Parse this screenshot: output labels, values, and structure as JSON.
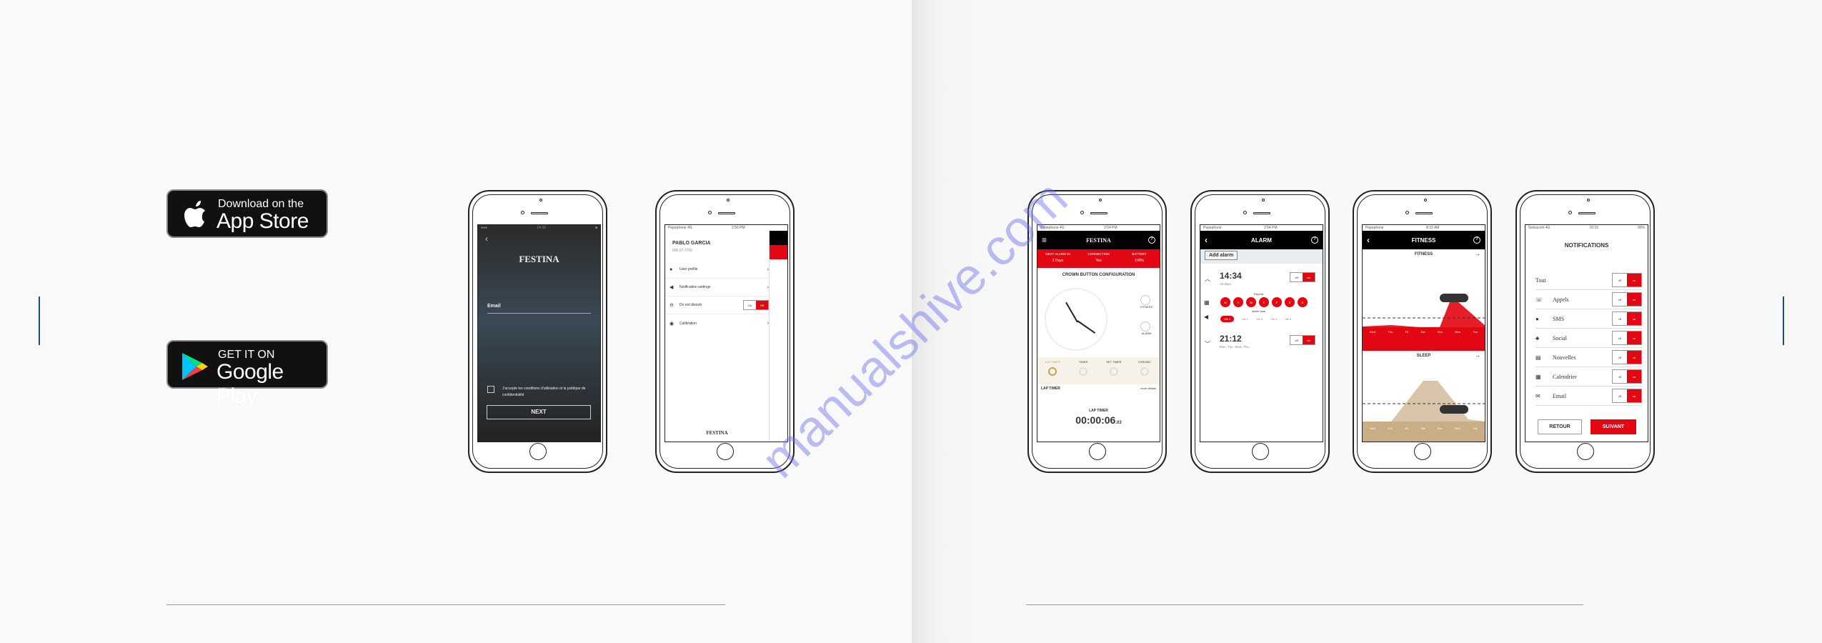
{
  "badges": {
    "appstore": {
      "small": "Download on the",
      "big": "App Store"
    },
    "googleplay": {
      "small": "GET IT ON",
      "big": "Google Play"
    }
  },
  "watermark": "manualshive.com",
  "login": {
    "brand": "FESTINA",
    "email_label": "Email",
    "terms": "J'accepte les conditions d'utilisation et la politique de confidentialité",
    "next": "NEXT"
  },
  "menu": {
    "name": "PABLO GARCIA",
    "id": "005.07.7700",
    "items": [
      {
        "label": "User profile",
        "icon": "user-icon"
      },
      {
        "label": "Notification settings",
        "icon": "megaphone-icon"
      },
      {
        "label": "Do not disturb",
        "icon": "dnd-icon"
      },
      {
        "label": "Calibration",
        "icon": "clock-icon"
      }
    ],
    "toggle_on": "On",
    "toggle_off": "Off",
    "brand": "FESTINA"
  },
  "crown": {
    "brand": "FESTINA",
    "stats": [
      {
        "label": "NEXT ALARM IN",
        "value": "2 Days"
      },
      {
        "label": "CONNECTION",
        "value": "Yes"
      },
      {
        "label": "BATTERY",
        "value": "100%"
      }
    ],
    "title": "CROWN BUTTON CONFIGURATION",
    "side": [
      "FITNESS",
      "ALARM"
    ],
    "modes": [
      "LAP TIMER",
      "TIMER",
      "SET TIMER",
      "CHRONO"
    ],
    "section": "LAP TIMER",
    "more": "more details",
    "timer_label": "LAP TIMER",
    "timer_value": "00:00:06",
    "timer_ms": ".03"
  },
  "alarm": {
    "title": "ALARM",
    "add": "Add alarm",
    "alarms": [
      {
        "time": "14:34",
        "days": "All days",
        "on": true
      },
      {
        "time": "21:12",
        "days": "Mon. Tue. Wed. Thu.",
        "on": true
      }
    ],
    "repeat": "Repeat",
    "days": [
      "M",
      "T",
      "W",
      "T",
      "F",
      "S",
      "S"
    ],
    "tone_label": "Alarm tone",
    "tones": [
      "Vib 1",
      "Vib 2",
      "Vib 3",
      "Vib 4",
      "Vib 5"
    ],
    "off": "off",
    "on": "on"
  },
  "fitness": {
    "title": "FITNESS",
    "section1": "FITNESS",
    "section2": "SLEEP",
    "days": [
      "Wed",
      "Thu",
      "Fri",
      "Sat",
      "Sun",
      "Mon",
      "Tue"
    ],
    "colors": {
      "fitness": "#e30613",
      "sleep": "#c9ad85"
    }
  },
  "notifications": {
    "title": "NOTIFICATIONS",
    "items": [
      {
        "label": "Tout",
        "icon": ""
      },
      {
        "label": "Appels",
        "icon": "phone-icon"
      },
      {
        "label": "SMS",
        "icon": "chat-icon"
      },
      {
        "label": "Social",
        "icon": "people-icon"
      },
      {
        "label": "Nouvelles",
        "icon": "news-icon"
      },
      {
        "label": "Calendrier",
        "icon": "calendar-icon"
      },
      {
        "label": "Email",
        "icon": "mail-icon"
      }
    ],
    "off": "off",
    "on": "on",
    "back": "RETOUR",
    "next": "SUIVANT"
  },
  "colors": {
    "accent": "#e30613",
    "rule": "#1f4e79"
  }
}
